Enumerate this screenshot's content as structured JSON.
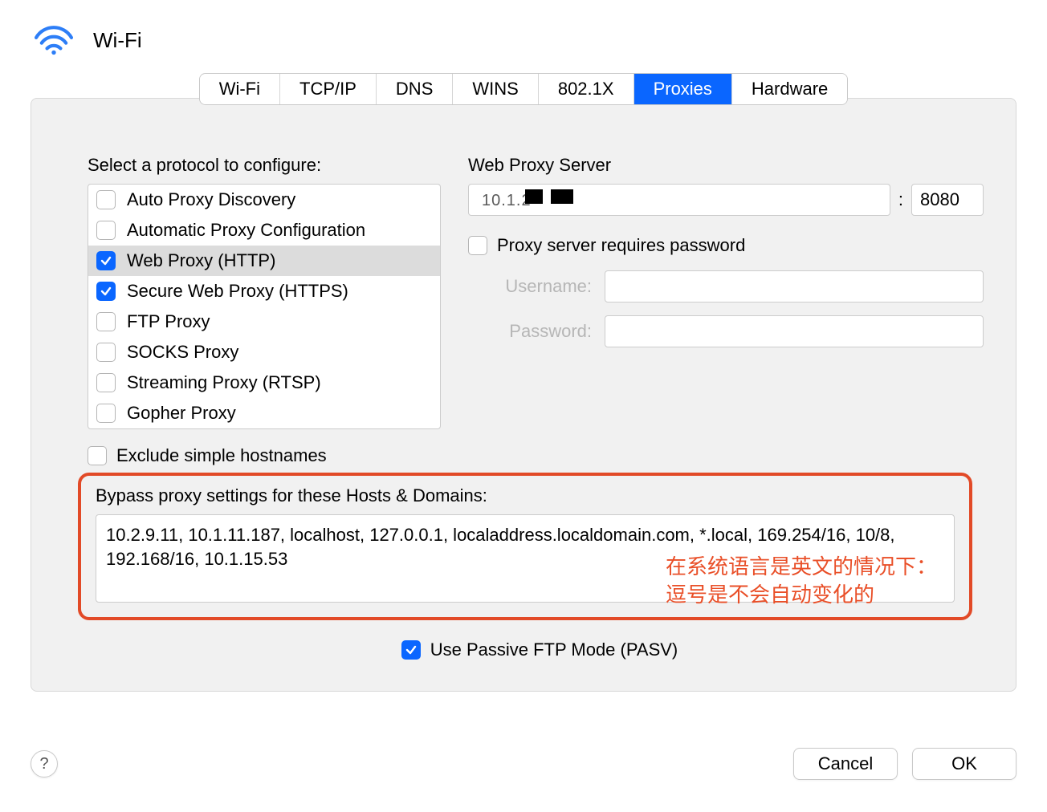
{
  "header": {
    "title": "Wi-Fi"
  },
  "tabs": [
    "Wi-Fi",
    "TCP/IP",
    "DNS",
    "WINS",
    "802.1X",
    "Proxies",
    "Hardware"
  ],
  "active_tab_index": 5,
  "left": {
    "select_label": "Select a protocol to configure:",
    "protocols": [
      {
        "label": "Auto Proxy Discovery",
        "checked": false
      },
      {
        "label": "Automatic Proxy Configuration",
        "checked": false
      },
      {
        "label": "Web Proxy (HTTP)",
        "checked": true,
        "selected": true
      },
      {
        "label": "Secure Web Proxy (HTTPS)",
        "checked": true
      },
      {
        "label": "FTP Proxy",
        "checked": false
      },
      {
        "label": "SOCKS Proxy",
        "checked": false
      },
      {
        "label": "Streaming Proxy (RTSP)",
        "checked": false
      },
      {
        "label": "Gopher Proxy",
        "checked": false
      }
    ]
  },
  "right": {
    "server_label": "Web Proxy Server",
    "server_host_partial": "10.1.2",
    "server_port": "8080",
    "colon": ":",
    "requires_password_label": "Proxy server requires password",
    "requires_password_checked": false,
    "username_label": "Username:",
    "password_label": "Password:",
    "username_value": "",
    "password_value": ""
  },
  "exclude": {
    "label": "Exclude simple hostnames",
    "checked": false
  },
  "bypass": {
    "label": "Bypass proxy settings for these Hosts & Domains:",
    "value": "10.2.9.11, 10.1.11.187, localhost, 127.0.0.1, localaddress.localdomain.com, *.local, 169.254/16, 10/8, 192.168/16, 10.1.15.53"
  },
  "annotation": {
    "line1": "在系统语言是英文的情况下：",
    "line2": "逗号是不会自动变化的"
  },
  "pasv": {
    "label": "Use Passive FTP Mode (PASV)",
    "checked": true
  },
  "footer": {
    "help": "?",
    "cancel": "Cancel",
    "ok": "OK"
  }
}
